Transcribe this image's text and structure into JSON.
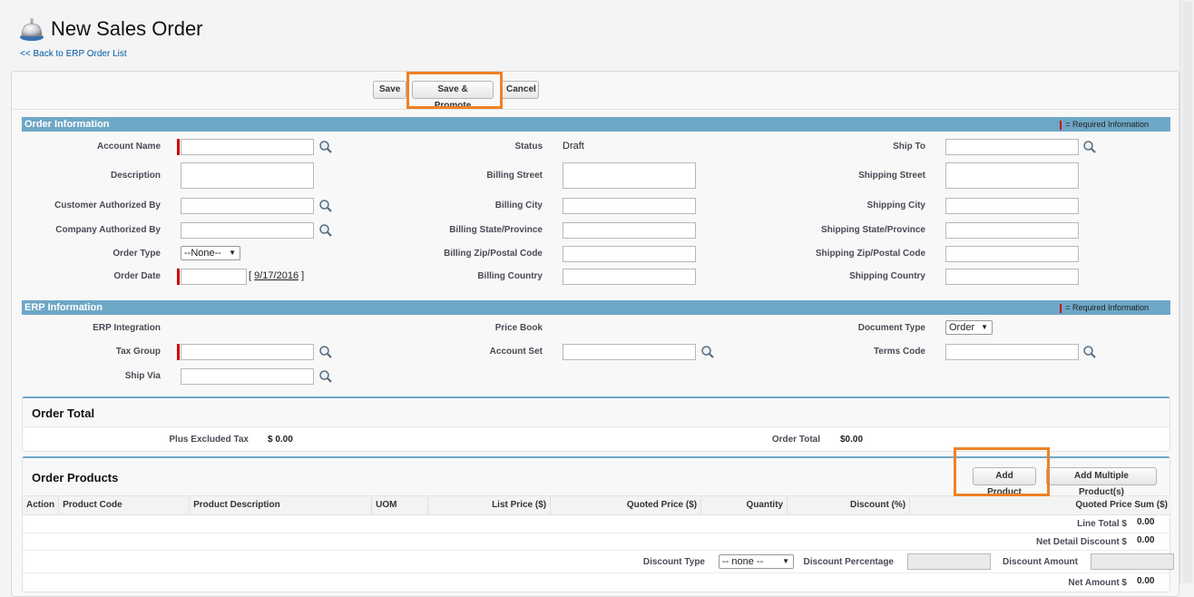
{
  "page": {
    "title": "New Sales Order",
    "back_link": "<< Back to ERP Order List"
  },
  "buttons": {
    "save": "Save",
    "save_promote": "Save & Promote",
    "cancel": "Cancel",
    "add_product": "Add Product",
    "add_multiple": "Add Multiple Product(s)"
  },
  "order_info": {
    "title": "Order Information",
    "required_info": "= Required Information",
    "account_name": "Account Name",
    "description": "Description",
    "customer_authorized_by": "Customer Authorized By",
    "company_authorized_by": "Company Authorized By",
    "order_type": "Order Type",
    "order_type_value": "--None--",
    "order_date": "Order Date",
    "order_date_link": "9/17/2016",
    "status": "Status",
    "status_value": "Draft",
    "billing_street": "Billing Street",
    "billing_city": "Billing City",
    "billing_state": "Billing State/Province",
    "billing_zip": "Billing Zip/Postal Code",
    "billing_country": "Billing Country",
    "ship_to": "Ship To",
    "shipping_street": "Shipping Street",
    "shipping_city": "Shipping City",
    "shipping_state": "Shipping State/Province",
    "shipping_zip": "Shipping Zip/Postal Code",
    "shipping_country": "Shipping Country"
  },
  "erp_info": {
    "title": "ERP Information",
    "required_info": "= Required Information",
    "erp_integration": "ERP Integration",
    "tax_group": "Tax Group",
    "ship_via": "Ship Via",
    "price_book": "Price Book",
    "account_set": "Account Set",
    "document_type": "Document Type",
    "document_type_value": "Order",
    "terms_code": "Terms Code"
  },
  "order_total": {
    "title": "Order Total",
    "plus_excluded_tax": "Plus Excluded Tax",
    "plus_excluded_tax_value": "$ 0.00",
    "order_total_label": "Order Total",
    "order_total_value": "$0.00"
  },
  "order_products": {
    "title": "Order Products",
    "columns": [
      "Action",
      "Product Code",
      "Product Description",
      "UOM",
      "List Price ($)",
      "Quoted Price ($)",
      "Quantity",
      "Discount (%)",
      "Quoted Price Sum ($)"
    ],
    "line_total_label": "Line Total $",
    "line_total_value": "0.00",
    "net_detail_discount_label": "Net Detail Discount $",
    "net_detail_discount_value": "0.00",
    "discount_type_label": "Discount Type",
    "discount_type_value": "-- none --",
    "discount_percentage_label": "Discount Percentage",
    "discount_amount_label": "Discount Amount",
    "net_amount_label": "Net Amount $",
    "net_amount_value": "0.00"
  },
  "colors": {
    "section_bar": "#6ea7c6",
    "highlight": "#f08125",
    "required": "#cc0000"
  }
}
